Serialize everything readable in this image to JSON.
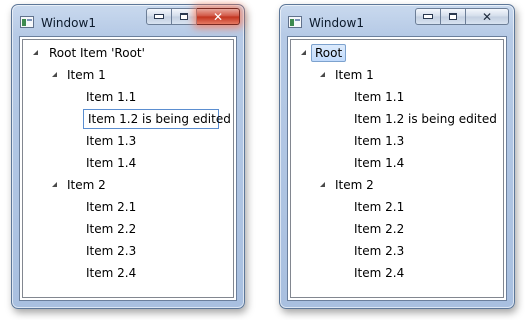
{
  "left_window": {
    "title": "Window1",
    "close_glyph": "✕",
    "tree": {
      "root_label": "Root Item 'Root'",
      "groups": [
        {
          "label": "Item 1",
          "children": [
            "Item 1.1",
            "Item 1.2 is being edited",
            "Item 1.3",
            "Item 1.4"
          ]
        },
        {
          "label": "Item 2",
          "children": [
            "Item 2.1",
            "Item 2.2",
            "Item 2.3",
            "Item 2.4"
          ]
        }
      ]
    }
  },
  "right_window": {
    "title": "Window1",
    "close_glyph": "✕",
    "tree": {
      "root_label": "Root",
      "groups": [
        {
          "label": "Item 1",
          "children": [
            "Item 1.1",
            "Item 1.2 is being edited",
            "Item 1.3",
            "Item 1.4"
          ]
        },
        {
          "label": "Item 2",
          "children": [
            "Item 2.1",
            "Item 2.2",
            "Item 2.3",
            "Item 2.4"
          ]
        }
      ]
    }
  }
}
